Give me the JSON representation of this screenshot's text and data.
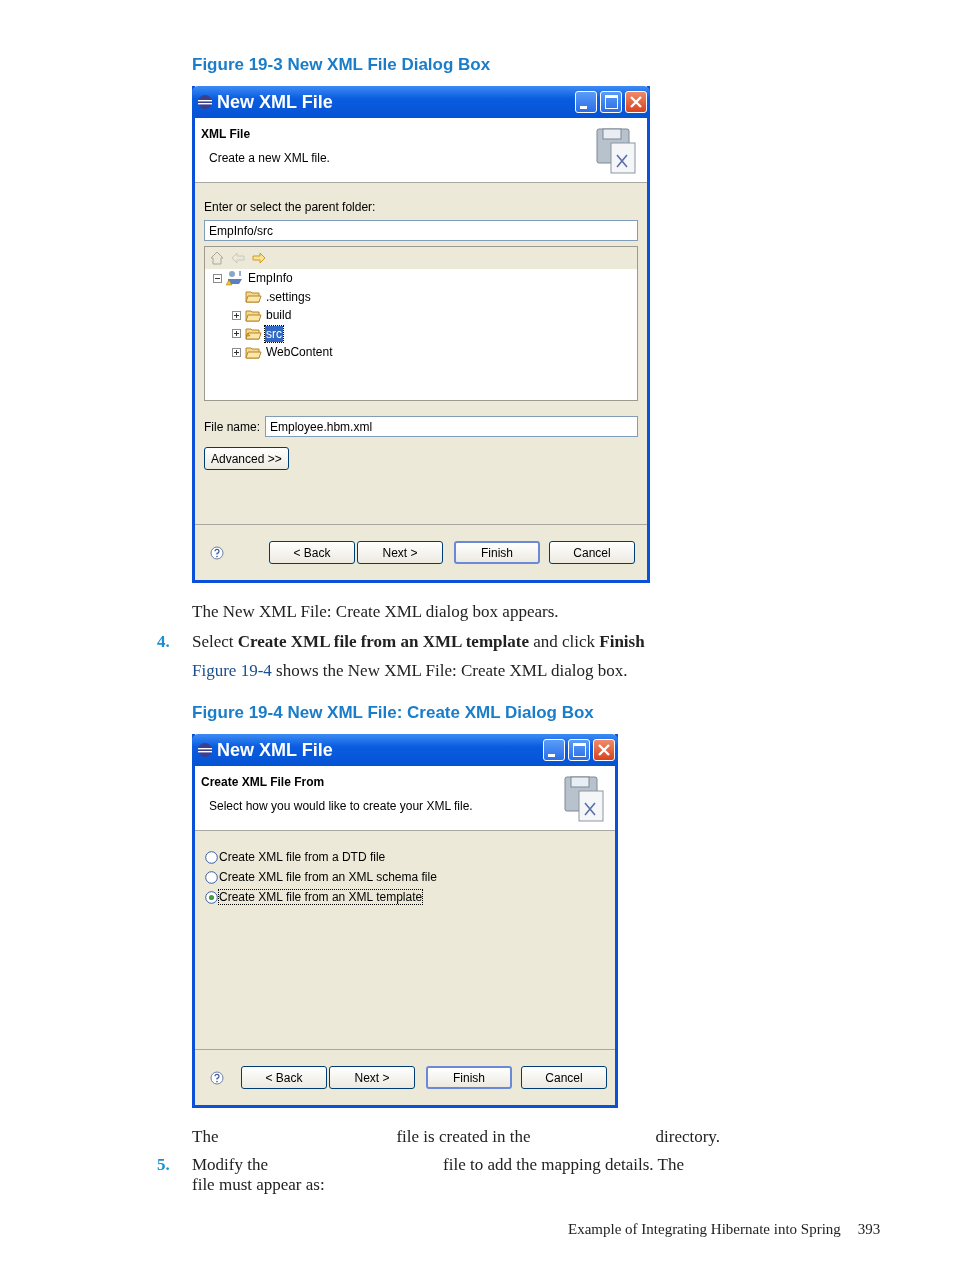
{
  "figure_1": {
    "caption": "Figure 19-3 New XML File Dialog Box",
    "dialog": {
      "title": "New XML File",
      "heading": "XML File",
      "description": "Create a new XML file.",
      "folder_label": "Enter or select the parent folder:",
      "folder_value": "EmpInfo/src",
      "tree": [
        {
          "label": "EmpInfo",
          "kind": "project",
          "expanded": true,
          "selected": false,
          "children": [
            {
              "label": ".settings",
              "kind": "folder",
              "selected": false
            },
            {
              "label": "build",
              "kind": "folder",
              "expanded": false,
              "selected": false
            },
            {
              "label": "src",
              "kind": "source",
              "expanded": false,
              "selected": true
            },
            {
              "label": "WebContent",
              "kind": "folder",
              "expanded": false,
              "selected": false
            }
          ]
        }
      ],
      "file_name_label": "File name:",
      "file_name": "Employee.hbm.xml",
      "advanced_button": "Advanced >>",
      "buttons": [
        {
          "label": "< Back",
          "default": false
        },
        {
          "label": "Next >",
          "default": false
        },
        {
          "label": "Finish",
          "default": true
        },
        {
          "label": "Cancel",
          "default": false
        }
      ]
    }
  },
  "paragraph_1": "The New XML File: Create XML dialog box appears.",
  "step_4": {
    "number": "4.",
    "text": "Select **Create XML file from an XML template** and click **Finish**",
    "link": "Figure 19-4",
    "text_2": "shows the New XML File: Create XML dialog box."
  },
  "figure_2": {
    "caption": "Figure 19-4 New XML File: Create XML Dialog Box",
    "dialog": {
      "title": "New XML File",
      "heading": "Create XML File From",
      "description": "Select how you would like to create your XML file.",
      "options": [
        {
          "label": "Create XML file from a DTD file",
          "selected": false
        },
        {
          "label": "Create XML file from an XML schema file",
          "selected": false
        },
        {
          "label": "Create XML file from an XML template",
          "selected": true
        }
      ],
      "buttons": [
        {
          "label": "< Back",
          "default": false
        },
        {
          "label": "Next >",
          "default": false
        },
        {
          "label": "Finish",
          "default": true
        },
        {
          "label": "Cancel",
          "default": false
        }
      ]
    }
  },
  "paragraph_2": [
    "The",
    "file is created in the",
    "directory."
  ],
  "step_5": {
    "number": "5.",
    "parts": [
      "Modify the",
      "file to add the mapping details. The"
    ],
    "line_2": "file must appear as:"
  },
  "footer": {
    "title": "Example of Integrating Hibernate into Spring",
    "page": "393"
  }
}
